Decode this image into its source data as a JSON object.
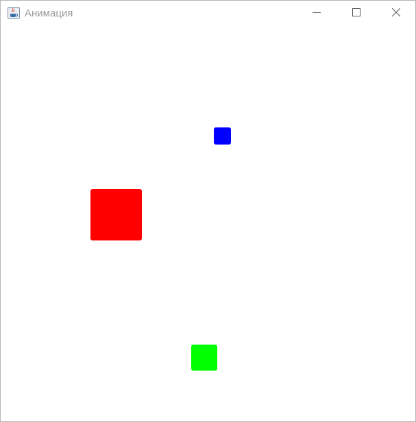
{
  "window": {
    "title": "Анимация",
    "app_icon": "java-coffee-cup-icon",
    "controls": {
      "minimize_icon": "minimize-icon",
      "maximize_icon": "maximize-icon",
      "close_icon": "close-icon"
    }
  },
  "canvas": {
    "background": "#ffffff",
    "squares": [
      {
        "name": "blue-square",
        "color": "#0000ff"
      },
      {
        "name": "red-square",
        "color": "#ff0000"
      },
      {
        "name": "green-square",
        "color": "#00ff00"
      }
    ]
  }
}
